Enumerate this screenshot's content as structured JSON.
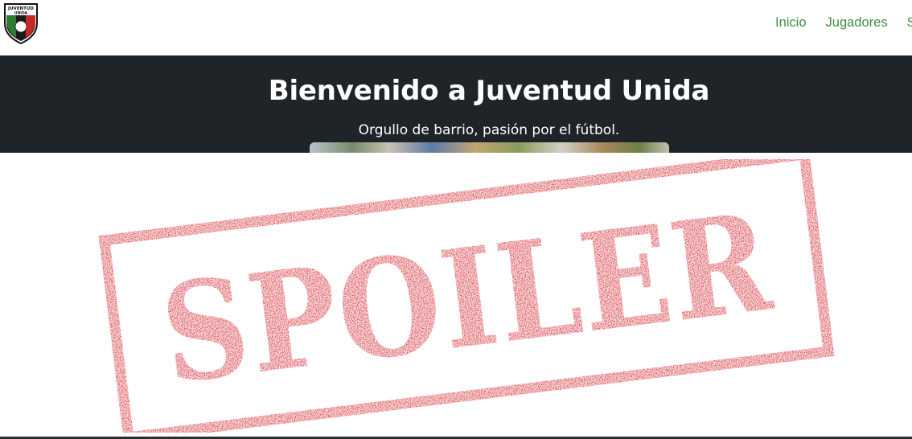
{
  "logo": {
    "text_line1": "JUVENTUD",
    "text_line2": "UNIDA"
  },
  "nav": {
    "items": [
      {
        "label": "Inicio"
      },
      {
        "label": "Jugadores"
      },
      {
        "label": "So"
      }
    ]
  },
  "hero": {
    "title": "Bienvenido a Juventud Unida",
    "subtitle": "Orgullo de barrio, pasión por el fútbol."
  },
  "spoiler": {
    "label": "SPOILER"
  },
  "colors": {
    "nav_link": "#3f8f3f",
    "hero_bg": "#1f2429",
    "stamp_red": "#d3202a"
  }
}
